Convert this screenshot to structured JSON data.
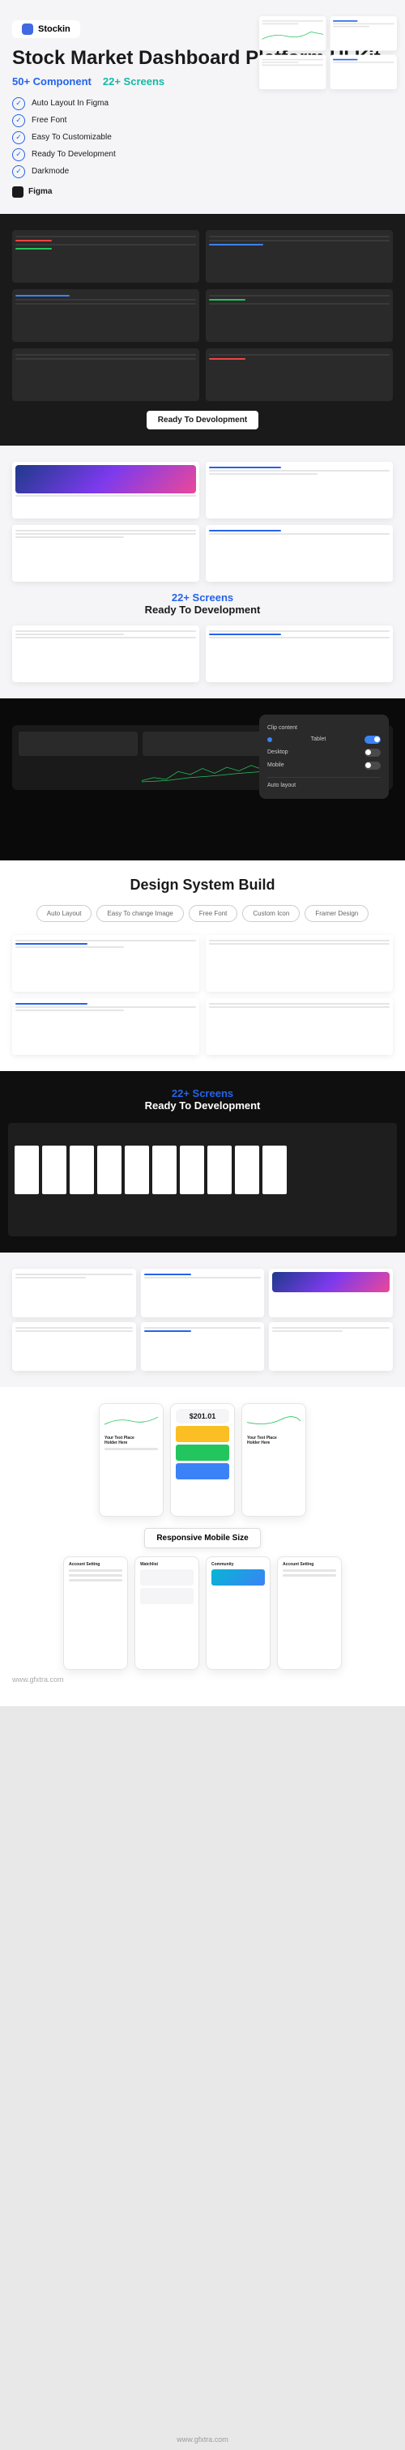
{
  "hero": {
    "logo": "Stockin",
    "title": "Stock Market Dashboard Platform UI Kit",
    "stat1": "50+ Component",
    "stat2": "22+ Screens",
    "features": [
      "Auto Layout In Figma",
      "Free Font",
      "Easy To Customizable",
      "Ready To Development",
      "Darkmode"
    ],
    "tool": "Figma"
  },
  "dark": {
    "badge": "Ready To Devolopment"
  },
  "light": {
    "count": "22+ Screens",
    "sub": "Ready To Development"
  },
  "panel": {
    "title": "Clip content",
    "item1": "Tablet",
    "item2": "Desktop",
    "item3": "Mobile",
    "section": "Auto layout"
  },
  "design": {
    "title": "Design System Build",
    "pills": [
      "Auto Layout",
      "Easy To change Image",
      "Free Font",
      "Custom Icon",
      "Framer Design"
    ]
  },
  "editor": {
    "count": "22+ Screens",
    "sub": "Ready To Development"
  },
  "responsive": {
    "badge": "Responsive Mobile Size",
    "placeholder": "Your Text Place Holder Here",
    "price": "$201.01",
    "card1": "Account Setting",
    "card2": "Watchlist",
    "card3": "Community"
  },
  "watermark": "www.gfxtra.com"
}
